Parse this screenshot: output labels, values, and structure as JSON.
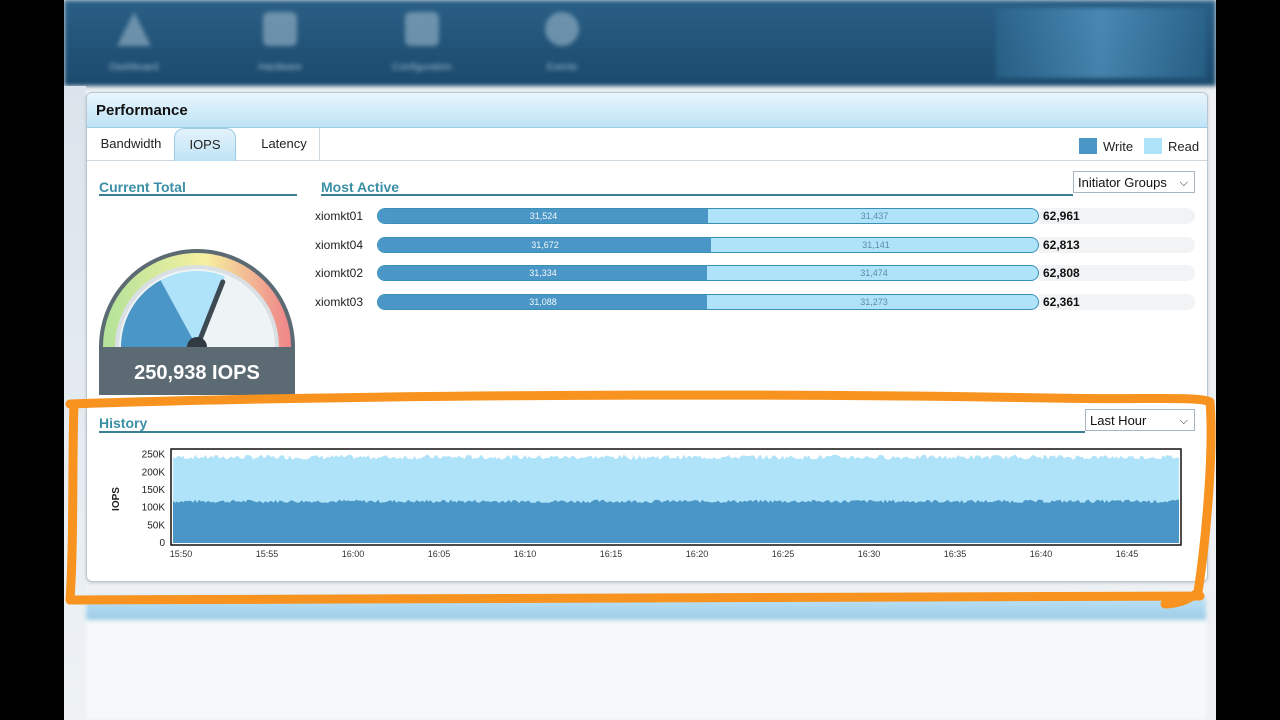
{
  "nav": {
    "items": [
      "Dashboard",
      "Hardware",
      "Configuration",
      "Events"
    ]
  },
  "panel": {
    "title": "Performance",
    "tabs": [
      {
        "label": "Bandwidth",
        "active": false
      },
      {
        "label": "IOPS",
        "active": true
      },
      {
        "label": "Latency",
        "active": false
      }
    ],
    "legend": [
      {
        "label": "Write",
        "color": "#4a96c6"
      },
      {
        "label": "Read",
        "color": "#aee3fa"
      }
    ]
  },
  "current_total": {
    "title": "Current Total",
    "value": "250,938 IOPS",
    "gauge_fraction": 0.62
  },
  "most_active": {
    "title": "Most Active",
    "filter": "Initiator Groups",
    "rows": [
      {
        "name": "xiomkt01",
        "write": "31,524",
        "read": "31,437",
        "total": "62,961",
        "write_n": 31524,
        "read_n": 31437
      },
      {
        "name": "xiomkt04",
        "write": "31,672",
        "read": "31,141",
        "total": "62,813",
        "write_n": 31672,
        "read_n": 31141
      },
      {
        "name": "xiomkt02",
        "write": "31,334",
        "read": "31,474",
        "total": "62,808",
        "write_n": 31334,
        "read_n": 31474
      },
      {
        "name": "xiomkt03",
        "write": "31,088",
        "read": "31,273",
        "total": "62,361",
        "write_n": 31088,
        "read_n": 31273
      }
    ]
  },
  "history": {
    "title": "History",
    "range": "Last Hour"
  },
  "chart_data": {
    "type": "area",
    "title": "",
    "xlabel": "",
    "ylabel": "IOPS",
    "x": [
      "15:50",
      "15:55",
      "16:00",
      "16:05",
      "16:10",
      "16:15",
      "16:20",
      "16:25",
      "16:30",
      "16:35",
      "16:40",
      "16:45"
    ],
    "yticks": [
      "0",
      "50K",
      "100K",
      "150K",
      "200K",
      "250K"
    ],
    "ylim": [
      0,
      250000
    ],
    "series": [
      {
        "name": "Write",
        "color": "#4a96c6",
        "values": [
          118000,
          118000,
          118000,
          118000,
          118000,
          118000,
          118000,
          118000,
          118000,
          118000,
          118000,
          118000
        ]
      },
      {
        "name": "Read",
        "color": "#aee3fa",
        "values": [
          125000,
          125000,
          125000,
          125000,
          125000,
          125000,
          125000,
          125000,
          125000,
          125000,
          125000,
          125000
        ]
      }
    ],
    "grid": false
  },
  "colors": {
    "annotation": "#f7931e",
    "accent": "#3a8fa6"
  }
}
